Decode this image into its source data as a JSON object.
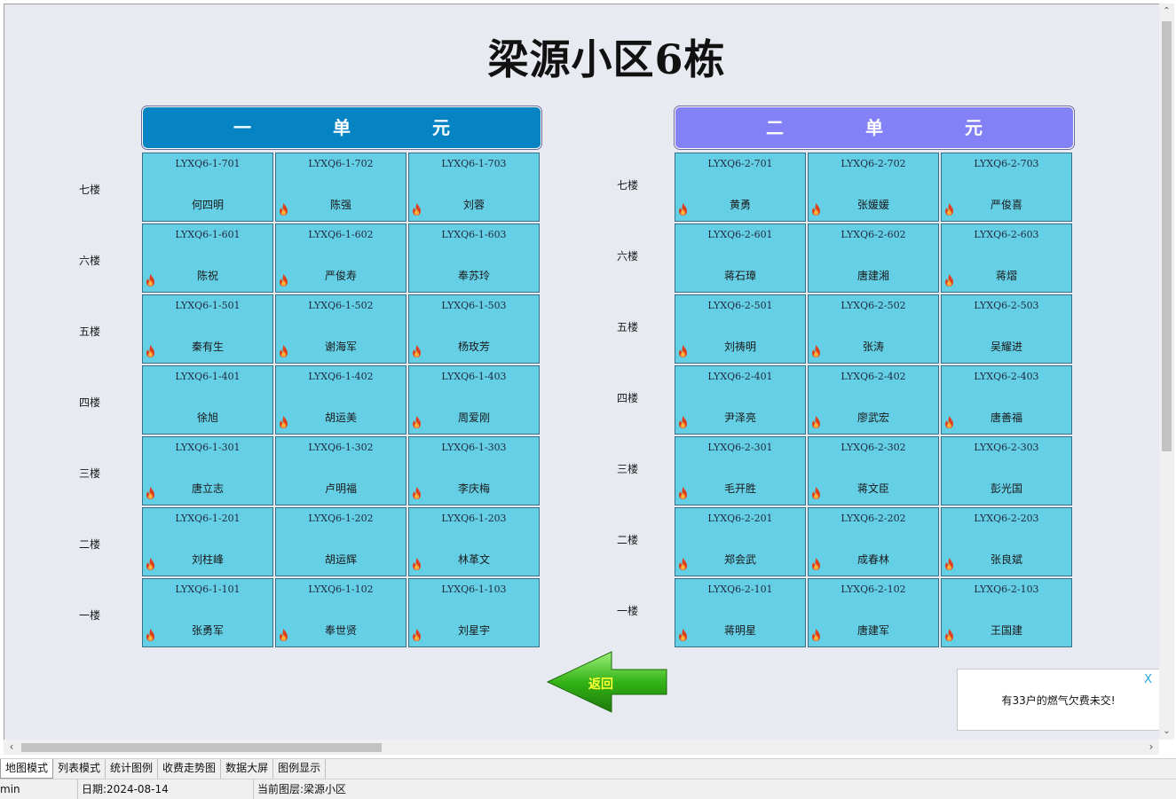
{
  "page": {
    "title": "梁源小区6栋",
    "back_label": "返回"
  },
  "units": [
    {
      "name": "一　单　元",
      "floors": [
        "七楼",
        "六楼",
        "五楼",
        "四楼",
        "三楼",
        "二楼",
        "一楼"
      ],
      "rooms": [
        [
          {
            "code": "LYXQ6-1-701",
            "name": "何四明",
            "fire": false
          },
          {
            "code": "LYXQ6-1-702",
            "name": "陈强",
            "fire": true
          },
          {
            "code": "LYXQ6-1-703",
            "name": "刘蓉",
            "fire": true
          }
        ],
        [
          {
            "code": "LYXQ6-1-601",
            "name": "陈祝",
            "fire": true
          },
          {
            "code": "LYXQ6-1-602",
            "name": "严俊寿",
            "fire": true
          },
          {
            "code": "LYXQ6-1-603",
            "name": "奉苏玲",
            "fire": false
          }
        ],
        [
          {
            "code": "LYXQ6-1-501",
            "name": "秦有生",
            "fire": true
          },
          {
            "code": "LYXQ6-1-502",
            "name": "谢海军",
            "fire": true
          },
          {
            "code": "LYXQ6-1-503",
            "name": "杨玫芳",
            "fire": true
          }
        ],
        [
          {
            "code": "LYXQ6-1-401",
            "name": "徐旭",
            "fire": false
          },
          {
            "code": "LYXQ6-1-402",
            "name": "胡运美",
            "fire": true
          },
          {
            "code": "LYXQ6-1-403",
            "name": "周爱刚",
            "fire": true
          }
        ],
        [
          {
            "code": "LYXQ6-1-301",
            "name": "唐立志",
            "fire": true
          },
          {
            "code": "LYXQ6-1-302",
            "name": "卢明福",
            "fire": false
          },
          {
            "code": "LYXQ6-1-303",
            "name": "李庆梅",
            "fire": true
          }
        ],
        [
          {
            "code": "LYXQ6-1-201",
            "name": "刘柱峰",
            "fire": true
          },
          {
            "code": "LYXQ6-1-202",
            "name": "胡运辉",
            "fire": false
          },
          {
            "code": "LYXQ6-1-203",
            "name": "林革文",
            "fire": true
          }
        ],
        [
          {
            "code": "LYXQ6-1-101",
            "name": "张勇军",
            "fire": true
          },
          {
            "code": "LYXQ6-1-102",
            "name": "奉世贤",
            "fire": true
          },
          {
            "code": "LYXQ6-1-103",
            "name": "刘星宇",
            "fire": true
          }
        ]
      ]
    },
    {
      "name": "二　单　元",
      "floors": [
        "七楼",
        "六楼",
        "五楼",
        "四楼",
        "三楼",
        "二楼",
        "一楼"
      ],
      "rooms": [
        [
          {
            "code": "LYXQ6-2-701",
            "name": "黄勇",
            "fire": true
          },
          {
            "code": "LYXQ6-2-702",
            "name": "张媛媛",
            "fire": true
          },
          {
            "code": "LYXQ6-2-703",
            "name": "严俊喜",
            "fire": true
          }
        ],
        [
          {
            "code": "LYXQ6-2-601",
            "name": "蒋石璋",
            "fire": false
          },
          {
            "code": "LYXQ6-2-602",
            "name": "唐建湘",
            "fire": false
          },
          {
            "code": "LYXQ6-2-603",
            "name": "蒋熠",
            "fire": true
          }
        ],
        [
          {
            "code": "LYXQ6-2-501",
            "name": "刘祷明",
            "fire": true
          },
          {
            "code": "LYXQ6-2-502",
            "name": "张涛",
            "fire": true
          },
          {
            "code": "LYXQ6-2-503",
            "name": "吴耀进",
            "fire": false
          }
        ],
        [
          {
            "code": "LYXQ6-2-401",
            "name": "尹泽亮",
            "fire": true
          },
          {
            "code": "LYXQ6-2-402",
            "name": "廖武宏",
            "fire": true
          },
          {
            "code": "LYXQ6-2-403",
            "name": "唐善福",
            "fire": true
          }
        ],
        [
          {
            "code": "LYXQ6-2-301",
            "name": "毛开胜",
            "fire": true
          },
          {
            "code": "LYXQ6-2-302",
            "name": "蒋文臣",
            "fire": true
          },
          {
            "code": "LYXQ6-2-303",
            "name": "彭光国",
            "fire": false
          }
        ],
        [
          {
            "code": "LYXQ6-2-201",
            "name": "郑会武",
            "fire": true
          },
          {
            "code": "LYXQ6-2-202",
            "name": "成春林",
            "fire": true
          },
          {
            "code": "LYXQ6-2-203",
            "name": "张良斌",
            "fire": true
          }
        ],
        [
          {
            "code": "LYXQ6-2-101",
            "name": "蒋明星",
            "fire": true
          },
          {
            "code": "LYXQ6-2-102",
            "name": "唐建军",
            "fire": true
          },
          {
            "code": "LYXQ6-2-103",
            "name": "王国建",
            "fire": true
          }
        ]
      ]
    }
  ],
  "notice": {
    "close": "X",
    "message": "有33户的燃气欠费未交!"
  },
  "tabs": [
    "地图模式",
    "列表模式",
    "统计图例",
    "收费走势图",
    "数据大屏",
    "图例显示"
  ],
  "status": {
    "user": "min",
    "date": "日期:2024-08-14",
    "layer": "当前图层:梁源小区"
  },
  "colors": {
    "unit1": "#0583c2",
    "unit2": "#8381f6",
    "room": "#65cfe6",
    "fire": "#e0401c"
  }
}
